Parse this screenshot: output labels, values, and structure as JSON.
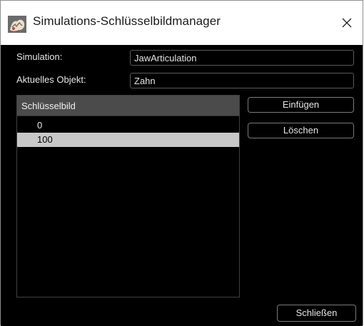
{
  "window": {
    "title": "Simulations-Schlüsselbildmanager",
    "icon": "tooth-icon",
    "close_icon": "close-icon"
  },
  "form": {
    "simulation_label": "Simulation:",
    "simulation_value": "JawArticulation",
    "object_label": "Aktuelles Objekt:",
    "object_value": "Zahn"
  },
  "keyframes": {
    "header": "Schlüsselbild",
    "items": [
      "0",
      "100"
    ],
    "selected_index": 1
  },
  "buttons": {
    "insert": "Einfügen",
    "delete": "Löschen",
    "close": "Schließen"
  },
  "colors": {
    "background": "#000000",
    "header": "#4b4b4b",
    "selection": "#c8c8c8"
  }
}
